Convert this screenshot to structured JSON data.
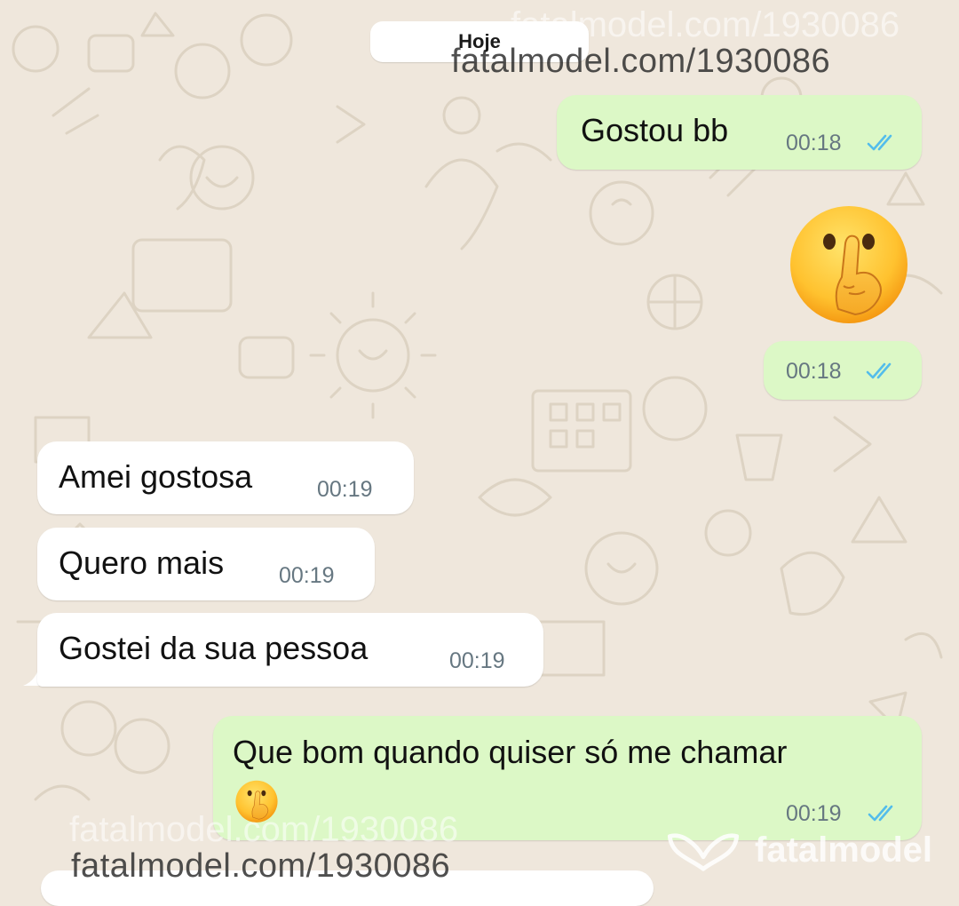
{
  "chat": {
    "date_separator": "Hoje",
    "messages": [
      {
        "direction": "outgoing",
        "text": "Gostou bb",
        "time": "00:18",
        "status": "read"
      },
      {
        "direction": "outgoing",
        "emoji": "shushing-face",
        "time": "00:18",
        "status": "read"
      },
      {
        "direction": "incoming",
        "text": "Amei gostosa",
        "time": "00:19"
      },
      {
        "direction": "incoming",
        "text": "Quero mais",
        "time": "00:19"
      },
      {
        "direction": "incoming",
        "text": "Gostei da sua pessoa",
        "time": "00:19"
      },
      {
        "direction": "outgoing",
        "text": "Que bom quando quiser só me chamar",
        "time": "00:19",
        "status": "read"
      }
    ]
  },
  "watermarks": {
    "top": "fatalmodel.com/1930086",
    "top_faint": "fatalmodel.com/1930086",
    "bottom": "fatalmodel.com/1930086",
    "bottom_faint": "fatalmodel.com/1930086",
    "brand": "fatalmodel"
  },
  "colors": {
    "wallpaper": "#efe7dc",
    "outgoing_bubble": "#dcf8c6",
    "incoming_bubble": "#ffffff",
    "read_ticks": "#53bdeb",
    "timestamp": "#667781"
  }
}
